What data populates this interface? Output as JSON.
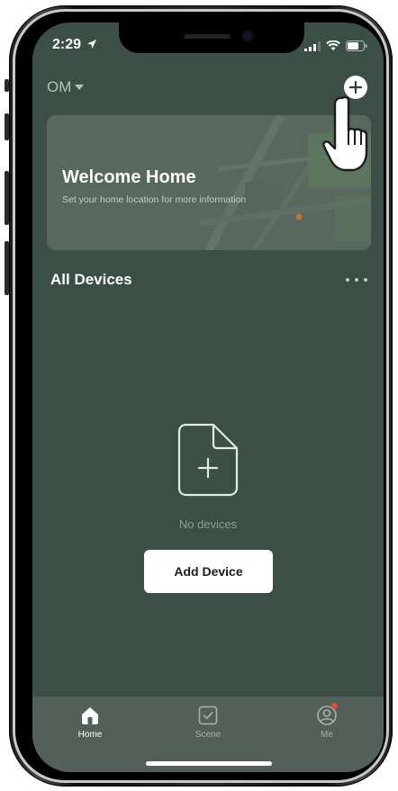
{
  "status_bar": {
    "time": "2:29"
  },
  "header": {
    "home_name": "OM"
  },
  "welcome_card": {
    "title": "Welcome Home",
    "subtitle": "Set your home location for more information"
  },
  "devices": {
    "section_title": "All Devices",
    "empty_text": "No devices",
    "add_button_label": "Add Device"
  },
  "tabbar": {
    "tabs": [
      {
        "label": "Home",
        "icon": "home-icon",
        "active": true
      },
      {
        "label": "Scene",
        "icon": "scene-icon",
        "active": false
      },
      {
        "label": "Me",
        "icon": "profile-icon",
        "active": false
      }
    ]
  },
  "colors": {
    "background": "#3b4f47",
    "card": "#58685f",
    "tabbar": "#536059",
    "accent_badge": "#e0443a"
  }
}
